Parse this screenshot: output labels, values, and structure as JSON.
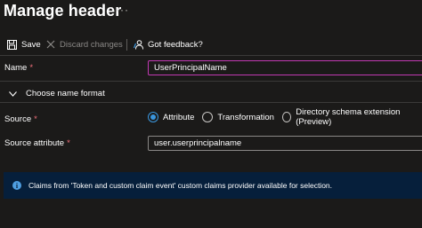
{
  "header": {
    "title": "Manage header",
    "more_label": "···"
  },
  "toolbar": {
    "save_label": "Save",
    "discard_label": "Discard changes",
    "feedback_label": "Got feedback?"
  },
  "form": {
    "name": {
      "label": "Name",
      "required_mark": "*",
      "value": "UserPrincipalName"
    },
    "name_format": {
      "label": "Choose name format"
    },
    "source": {
      "label": "Source",
      "required_mark": "*",
      "options": [
        {
          "label": "Attribute",
          "selected": true
        },
        {
          "label": "Transformation",
          "selected": false
        },
        {
          "label": "Directory schema extension (Preview)",
          "selected": false
        }
      ]
    },
    "source_attribute": {
      "label": "Source attribute",
      "required_mark": "*",
      "value": "user.userprincipalname"
    }
  },
  "info": {
    "icon": "info-icon",
    "text": "Claims from 'Token and custom claim event' custom claims provider available for selection."
  },
  "colors": {
    "background": "#1b1a19",
    "accent": "#3a96dd",
    "focus_border": "#c239b3",
    "required": "#f1707b",
    "info_bar": "#061f3b"
  }
}
